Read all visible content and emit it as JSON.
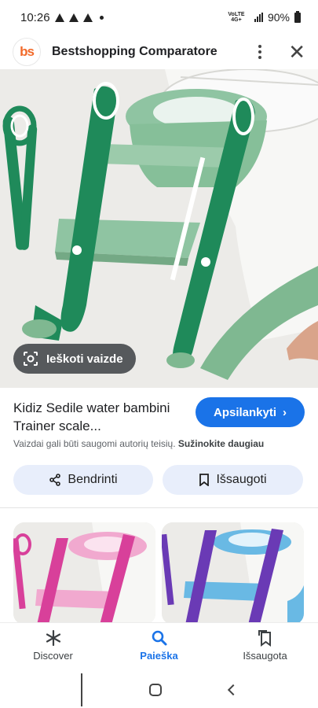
{
  "status_bar": {
    "time": "10:26",
    "network": "VoLTE 4G+",
    "battery": "90%"
  },
  "header": {
    "logo_text": "bs",
    "title": "Bestshopping Comparatore"
  },
  "image": {
    "lens_label": "Ieškoti vaizde"
  },
  "product": {
    "title": "Kidiz Sedile water bambini Trainer scale...",
    "visit_label": "Apsilankyti",
    "copyright_text": "Vaizdai gali būti saugomi autorių teisių.",
    "learn_more": "Sužinokite daugiau",
    "share_label": "Bendrinti",
    "save_label": "Išsaugoti"
  },
  "bottom_nav": {
    "items": [
      {
        "label": "Discover",
        "icon": "asterisk-icon",
        "active": false
      },
      {
        "label": "Paieška",
        "icon": "search-icon",
        "active": true
      },
      {
        "label": "Išsaugota",
        "icon": "saved-collections-icon",
        "active": false
      }
    ]
  },
  "colors": {
    "accent": "#1a73e8",
    "ladder_green": "#1f8a5a",
    "seat_green": "#8fc4a2",
    "pink": "#d8409a",
    "purple": "#6a3ab5",
    "blue": "#69b9e4"
  }
}
